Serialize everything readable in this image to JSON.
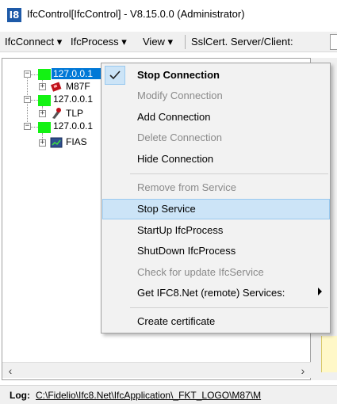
{
  "window": {
    "title": "IfcControl[IfcControl] - V8.15.0.0 (Administrator)",
    "icon_text": "I8"
  },
  "menubar": {
    "items": [
      "IfcConnect ▾",
      "IfcProcess ▾",
      "View ▾",
      "SslCert. Server/Client:"
    ]
  },
  "tree": {
    "nodes": [
      {
        "ip": "127.0.0.1",
        "child": "M87F",
        "child_icon": "red-device-icon"
      },
      {
        "ip": "127.0.0.1",
        "child": "TLP",
        "child_icon": "red-tool-icon"
      },
      {
        "ip": "127.0.0.1",
        "child": "FIAS",
        "child_icon": "chart-window-icon"
      }
    ]
  },
  "context_menu": {
    "items": [
      {
        "label": "Stop Connection",
        "style": "bold",
        "checked": true
      },
      {
        "label": "Modify Connection",
        "style": "disabled"
      },
      {
        "label": "Add Connection",
        "style": "normal"
      },
      {
        "label": "Delete Connection",
        "style": "disabled"
      },
      {
        "label": "Hide Connection",
        "style": "normal"
      },
      {
        "label": "Remove from Service",
        "style": "disabled"
      },
      {
        "label": "Stop Service",
        "style": "hover"
      },
      {
        "label": "StartUp IfcProcess",
        "style": "normal"
      },
      {
        "label": "ShutDown IfcProcess",
        "style": "normal"
      },
      {
        "label": "Check for update IfcService",
        "style": "disabled"
      },
      {
        "label": "Get IFC8.Net (remote) Services:",
        "style": "normal",
        "submenu": true
      },
      {
        "label": "Create certificate",
        "style": "normal"
      }
    ]
  },
  "statusbar": {
    "log_label": "Log:",
    "log_path": "C:\\Fidelio\\Ifc8.Net\\IfcApplication\\_FKT_LOGO\\M87\\M"
  },
  "colors": {
    "status_green": "#13f213",
    "selection_blue": "#0078d7",
    "menu_hover": "#cce4f7"
  }
}
